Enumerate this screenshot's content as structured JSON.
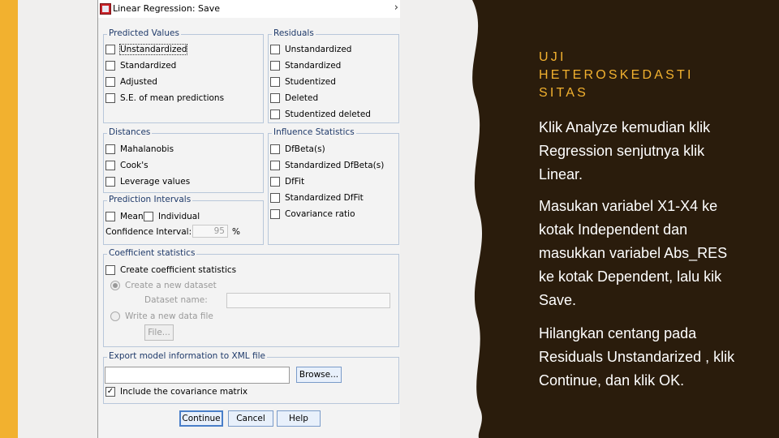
{
  "slide": {
    "title_lines": [
      "UJI",
      "HETEROSKEDASTI",
      "SITAS"
    ],
    "paragraphs": [
      "Klik Analyze kemudian klik Regression senjutnya klik Linear.",
      "Masukan variabel X1-X4 ke kotak Independent dan masukkan variabel Abs_RES ke kotak Dependent, lalu kik Save.",
      "Hilangkan centang pada Residuals Unstandarized , klik Continue, dan klik OK."
    ],
    "colors": {
      "accent": "#f2b12f",
      "dark_panel": "#2a1c0c",
      "text_light": "#ffffff"
    }
  },
  "dialog": {
    "title": "Linear Regression: Save",
    "close_glyph": "›",
    "predicted_values": {
      "legend": "Predicted Values",
      "options": [
        {
          "label": "Unstandardized",
          "checked": false
        },
        {
          "label": "Standardized",
          "checked": false
        },
        {
          "label": "Adjusted",
          "checked": false
        },
        {
          "label": "S.E. of mean predictions",
          "checked": false
        }
      ]
    },
    "residuals": {
      "legend": "Residuals",
      "options": [
        {
          "label": "Unstandardized",
          "checked": false
        },
        {
          "label": "Standardized",
          "checked": false
        },
        {
          "label": "Studentized",
          "checked": false
        },
        {
          "label": "Deleted",
          "checked": false
        },
        {
          "label": "Studentized deleted",
          "checked": false
        }
      ]
    },
    "distances": {
      "legend": "Distances",
      "options": [
        {
          "label": "Mahalanobis",
          "checked": false
        },
        {
          "label": "Cook's",
          "checked": false
        },
        {
          "label": "Leverage values",
          "checked": false
        }
      ]
    },
    "influence": {
      "legend": "Influence Statistics",
      "options": [
        {
          "label": "DfBeta(s)",
          "checked": false
        },
        {
          "label": "Standardized DfBeta(s)",
          "checked": false
        },
        {
          "label": "DfFit",
          "checked": false
        },
        {
          "label": "Standardized DfFit",
          "checked": false
        },
        {
          "label": "Covariance ratio",
          "checked": false
        }
      ]
    },
    "prediction_intervals": {
      "legend": "Prediction Intervals",
      "mean_label": "Mean",
      "individual_label": "Individual",
      "ci_label": "Confidence Interval:",
      "ci_value": "95",
      "ci_unit": "%"
    },
    "coefficient_statistics": {
      "legend": "Coefficient statistics",
      "create_label": "Create coefficient statistics",
      "radio_new_dataset": "Create a new dataset",
      "dataset_name_label": "Dataset name:",
      "dataset_name_value": "",
      "radio_new_file": "Write a new data file",
      "file_button": "File..."
    },
    "export": {
      "legend": "Export model information to XML file",
      "path_value": "",
      "browse_button": "Browse...",
      "include_label": "Include the covariance matrix",
      "include_checked": true
    },
    "buttons": {
      "continue": "Continue",
      "cancel": "Cancel",
      "help": "Help"
    }
  }
}
